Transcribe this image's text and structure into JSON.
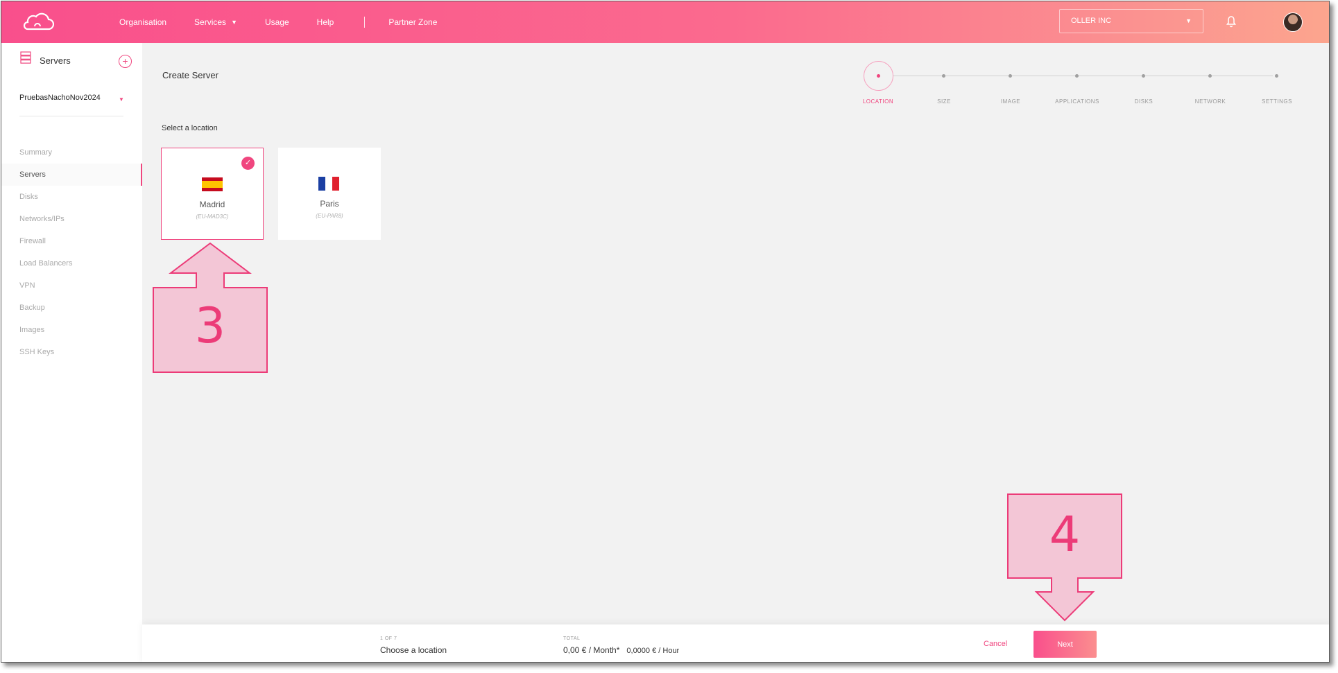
{
  "header": {
    "nav": [
      {
        "label": "Organisation"
      },
      {
        "label": "Services",
        "has_dropdown": true
      },
      {
        "label": "Usage"
      },
      {
        "label": "Help"
      }
    ],
    "partner_zone": "Partner Zone",
    "org_select": {
      "value": "OLLER INC"
    },
    "icons": {
      "logo": "cloud-logo-icon",
      "bell": "bell-icon",
      "avatar": "user-avatar"
    },
    "colors": {
      "gradient_start": "#f94f8c",
      "gradient_end": "#fca58e",
      "accent": "#f0467f"
    }
  },
  "sidebar": {
    "title": "Servers",
    "add_icon": "+",
    "project": "PruebasNachoNov2024",
    "items": [
      {
        "label": "Summary"
      },
      {
        "label": "Servers",
        "active": true
      },
      {
        "label": "Disks"
      },
      {
        "label": "Networks/IPs"
      },
      {
        "label": "Firewall"
      },
      {
        "label": "Load Balancers"
      },
      {
        "label": "VPN"
      },
      {
        "label": "Backup"
      },
      {
        "label": "Images"
      },
      {
        "label": "SSH Keys"
      }
    ]
  },
  "main": {
    "title": "Create Server",
    "steps": [
      "LOCATION",
      "SIZE",
      "IMAGE",
      "APPLICATIONS",
      "DISKS",
      "NETWORK",
      "SETTINGS"
    ],
    "active_step": 0,
    "section_label": "Select a location",
    "locations": [
      {
        "name": "Madrid",
        "code": "(EU-MAD3C)",
        "flag": "spain-flag-icon",
        "selected": true
      },
      {
        "name": "Paris",
        "code": "(EU-PAR8)",
        "flag": "france-flag-icon",
        "selected": false
      }
    ]
  },
  "annotations": [
    {
      "number": "3",
      "direction": "up"
    },
    {
      "number": "4",
      "direction": "down"
    }
  ],
  "footer": {
    "step_counter": "1 OF 7",
    "step_text": "Choose a location",
    "total_label": "TOTAL",
    "price_month": "0,00 € / Month*",
    "price_hour": "0,0000 € / Hour",
    "cancel": "Cancel",
    "next": "Next"
  }
}
